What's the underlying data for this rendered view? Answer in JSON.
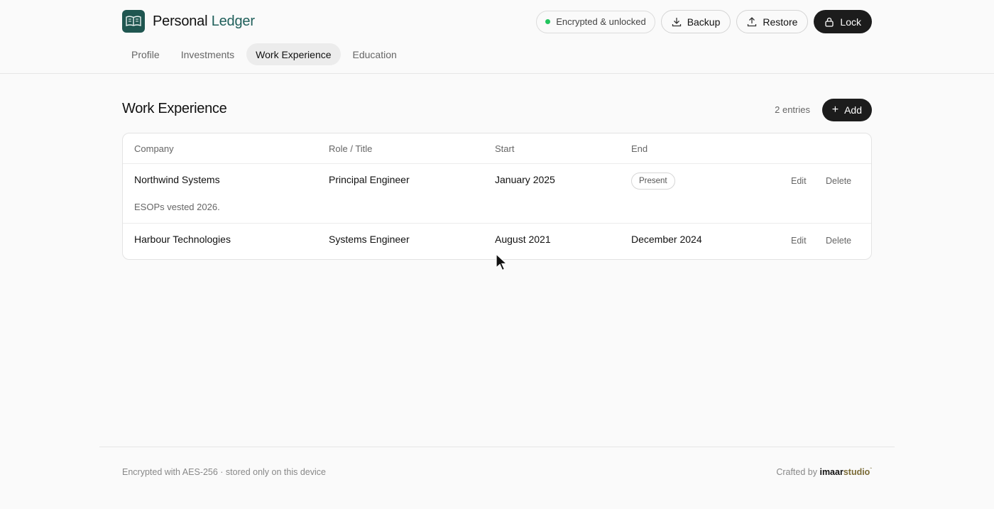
{
  "header": {
    "brand_first": "Personal",
    "brand_second": "Ledger",
    "status": "Encrypted & unlocked",
    "backup_label": "Backup",
    "restore_label": "Restore",
    "lock_label": "Lock"
  },
  "tabs": [
    {
      "label": "Profile"
    },
    {
      "label": "Investments"
    },
    {
      "label": "Work Experience",
      "active": true
    },
    {
      "label": "Education"
    }
  ],
  "main": {
    "title": "Work Experience",
    "entries_count": "2 entries",
    "add_label": "Add"
  },
  "table": {
    "headers": [
      "Company",
      "Role / Title",
      "Start",
      "End"
    ],
    "rows": [
      {
        "company": "Northwind Systems",
        "role": "Principal Engineer",
        "start": "January 2025",
        "end": "Present",
        "note": "ESOPs vested 2026.",
        "edit": "Edit",
        "delete": "Delete"
      },
      {
        "company": "Harbour Technologies",
        "role": "Systems Engineer",
        "start": "August 2021",
        "end": "December 2024",
        "edit": "Edit",
        "delete": "Delete"
      }
    ]
  },
  "footer": {
    "left": "Encrypted with AES-256 · stored only on this device",
    "crafted_by": "Crafted by",
    "studio_first": "imaar",
    "studio_second": "studio"
  },
  "colors": {
    "brand": "#1f5650",
    "status_dot": "#22c55e",
    "dark_button": "#1c1c1c"
  },
  "icons": [
    "book-icon",
    "download-icon",
    "upload-icon",
    "lock-icon",
    "plus-icon",
    "cursor-icon"
  ]
}
